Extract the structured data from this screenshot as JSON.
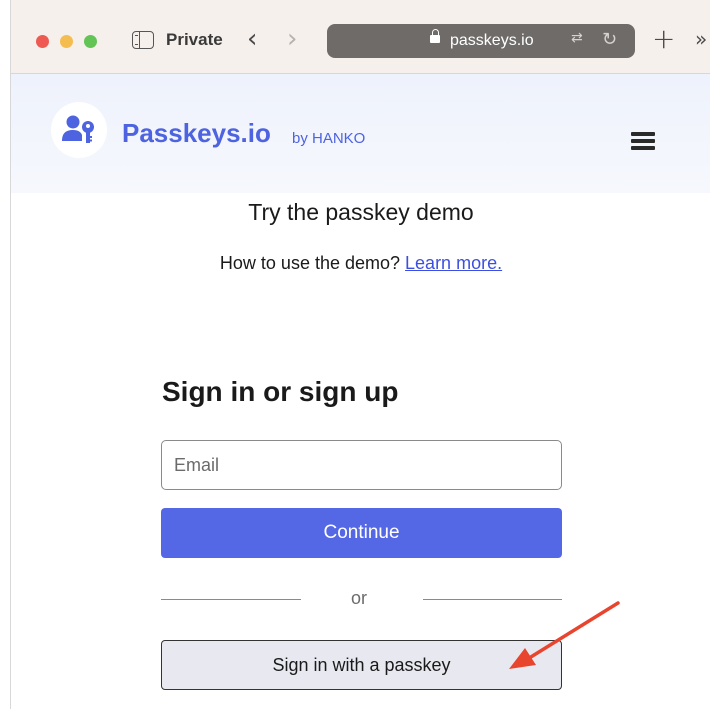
{
  "browser": {
    "private_label": "Private",
    "url": "passkeys.io",
    "back_glyph": "‹",
    "forward_glyph": "›",
    "icons": [
      "sidebar-icon",
      "back-icon",
      "forward-icon",
      "lock-icon",
      "translate-icon",
      "reload-icon",
      "new-tab-icon",
      "more-icon"
    ],
    "traffic_lights": {
      "close": "#ee5a52",
      "minimize": "#f5bd4f",
      "zoom": "#61c454"
    }
  },
  "header": {
    "brand": "Passkeys.io",
    "by_label": "by HANKO",
    "brand_color": "#4d63e0"
  },
  "demo": {
    "title": "Try the passkey demo",
    "help_text": "How to use the demo?",
    "help_link": "Learn more."
  },
  "form": {
    "heading": "Sign in or sign up",
    "email_placeholder": "Email",
    "email_value": "",
    "continue_label": "Continue",
    "divider_label": "or",
    "passkey_label": "Sign in with a passkey",
    "accent_color": "#5468e6"
  },
  "annotation": {
    "arrow_color": "#e8452f",
    "points_to": "passkey-button"
  }
}
